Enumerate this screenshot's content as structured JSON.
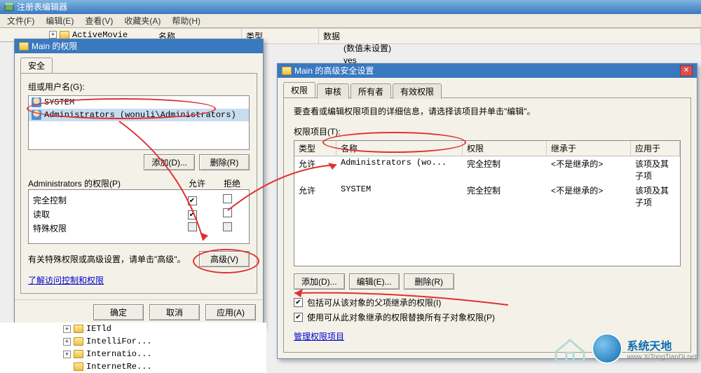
{
  "app": {
    "title": "注册表编辑器",
    "menus": [
      "文件(F)",
      "编辑(E)",
      "查看(V)",
      "收藏夹(A)",
      "帮助(H)"
    ],
    "tree_selected": "ActiveMovie",
    "cols": {
      "name": "名称",
      "type": "类型",
      "data": "数据"
    },
    "data_row1": "(数值未设置)",
    "data_row2": "yes"
  },
  "perm_dlg": {
    "title": "Main 的权限",
    "tab_security": "安全",
    "group_label": "组或用户名(G):",
    "users": [
      {
        "name": "SYSTEM"
      },
      {
        "name": "Administrators (wonuli\\Administrators)"
      }
    ],
    "btn_add": "添加(D)...",
    "btn_remove": "删除(R)",
    "perm_header": "Administrators 的权限(P)",
    "col_allow": "允许",
    "col_deny": "拒绝",
    "perms": [
      {
        "name": "完全控制",
        "allow": true,
        "deny": false
      },
      {
        "name": "读取",
        "allow": true,
        "deny": false
      },
      {
        "name": "特殊权限",
        "allow": false,
        "deny": false
      }
    ],
    "special_note": "有关特殊权限或高级设置，请单击\"高级\"。",
    "btn_advanced": "高级(V)",
    "link_help": "了解访问控制和权限",
    "btn_ok": "确定",
    "btn_cancel": "取消",
    "btn_apply": "应用(A)"
  },
  "adv_dlg": {
    "title": "Main 的高级安全设置",
    "tabs": [
      "权限",
      "审核",
      "所有者",
      "有效权限"
    ],
    "intro": "要查看或编辑权限项目的详细信息，请选择该项目并单击\"编辑\"。",
    "list_label": "权限项目(T):",
    "cols": {
      "type": "类型",
      "name": "名称",
      "perm": "权限",
      "inherit": "继承于",
      "apply": "应用于"
    },
    "rows": [
      {
        "type": "允许",
        "name": "Administrators (wo...",
        "perm": "完全控制",
        "inherit": "<不是继承的>",
        "apply": "该项及其子项"
      },
      {
        "type": "允许",
        "name": "SYSTEM",
        "perm": "完全控制",
        "inherit": "<不是继承的>",
        "apply": "该项及其子项"
      }
    ],
    "btn_add": "添加(D)...",
    "btn_edit": "编辑(E)...",
    "btn_remove": "删除(R)",
    "cb1": "包括可从该对象的父项继承的权限(I)",
    "cb2": "使用可从此对象继承的权限替换所有子对象权限(P)",
    "link_manage": "管理权限项目"
  },
  "tree_nodes": [
    "IETld",
    "IntelliFor...",
    "Internatio...",
    "InternetRe..."
  ],
  "logo": {
    "name": "系统天地",
    "url": "www.XiTongTianDi.net"
  }
}
